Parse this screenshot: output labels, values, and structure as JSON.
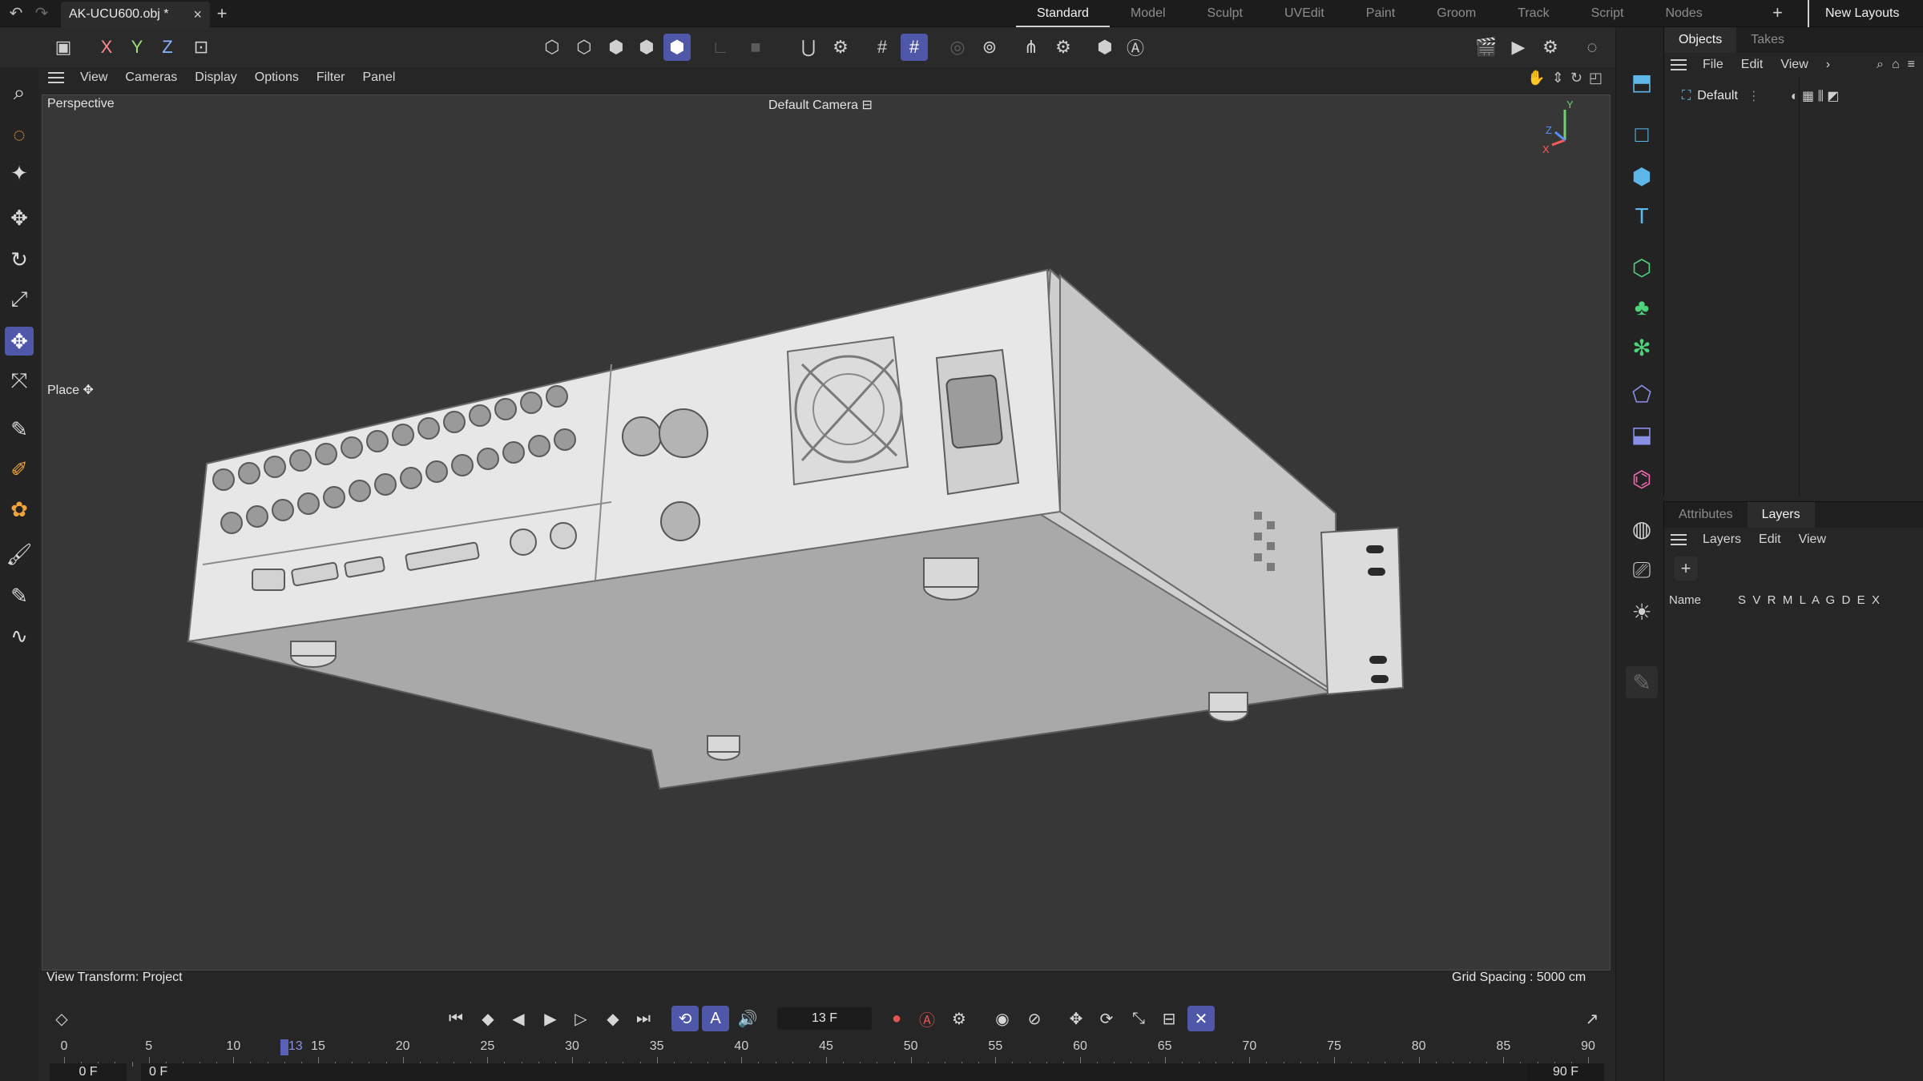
{
  "topbar": {
    "doc_tab": "AK-UCU600.obj *",
    "close": "×",
    "add_tab": "+",
    "layouts": [
      "Standard",
      "Model",
      "Sculpt",
      "UVEdit",
      "Paint",
      "Groom",
      "Track",
      "Script",
      "Nodes"
    ],
    "layout_add": "+",
    "new_layouts": "New Layouts"
  },
  "toolbar": {
    "axis_x": "X",
    "axis_y": "Y",
    "axis_z": "Z"
  },
  "viewmenu": {
    "items": [
      "View",
      "Cameras",
      "Display",
      "Options",
      "Filter",
      "Panel"
    ]
  },
  "viewport": {
    "projection": "Perspective",
    "camera": "Default Camera",
    "tool_label": "Place",
    "view_transform": "View Transform: Project",
    "grid_spacing": "Grid Spacing : 5000 cm",
    "gizmo_x": "X",
    "gizmo_y": "Y",
    "gizmo_z": "Z"
  },
  "objects": {
    "tabs": [
      "Objects",
      "Takes"
    ],
    "menu": [
      "File",
      "Edit",
      "View"
    ],
    "row_name": "Default"
  },
  "layers": {
    "tabs": [
      "Attributes",
      "Layers"
    ],
    "menu": [
      "Layers",
      "Edit",
      "View"
    ],
    "add": "+",
    "col_name": "Name",
    "col_flags": "S  V  R  M  L  A  G  D  E  X"
  },
  "timeline": {
    "current_frame": "13 F",
    "playhead_label": "13",
    "playhead_frame": 13,
    "tick_labels": [
      "0",
      "5",
      "10",
      "15",
      "20",
      "25",
      "30",
      "35",
      "40",
      "45",
      "50",
      "55",
      "60",
      "65",
      "70",
      "75",
      "80",
      "85",
      "90"
    ],
    "range_start": "0 F",
    "range_start2": "0 F",
    "range_end": "90 F",
    "range_end2": "90 F"
  },
  "colors": {
    "accent": "#4f57a8",
    "axis_x": "#ff8a8a",
    "axis_y": "#9de07a",
    "axis_z": "#8ab4ff"
  }
}
